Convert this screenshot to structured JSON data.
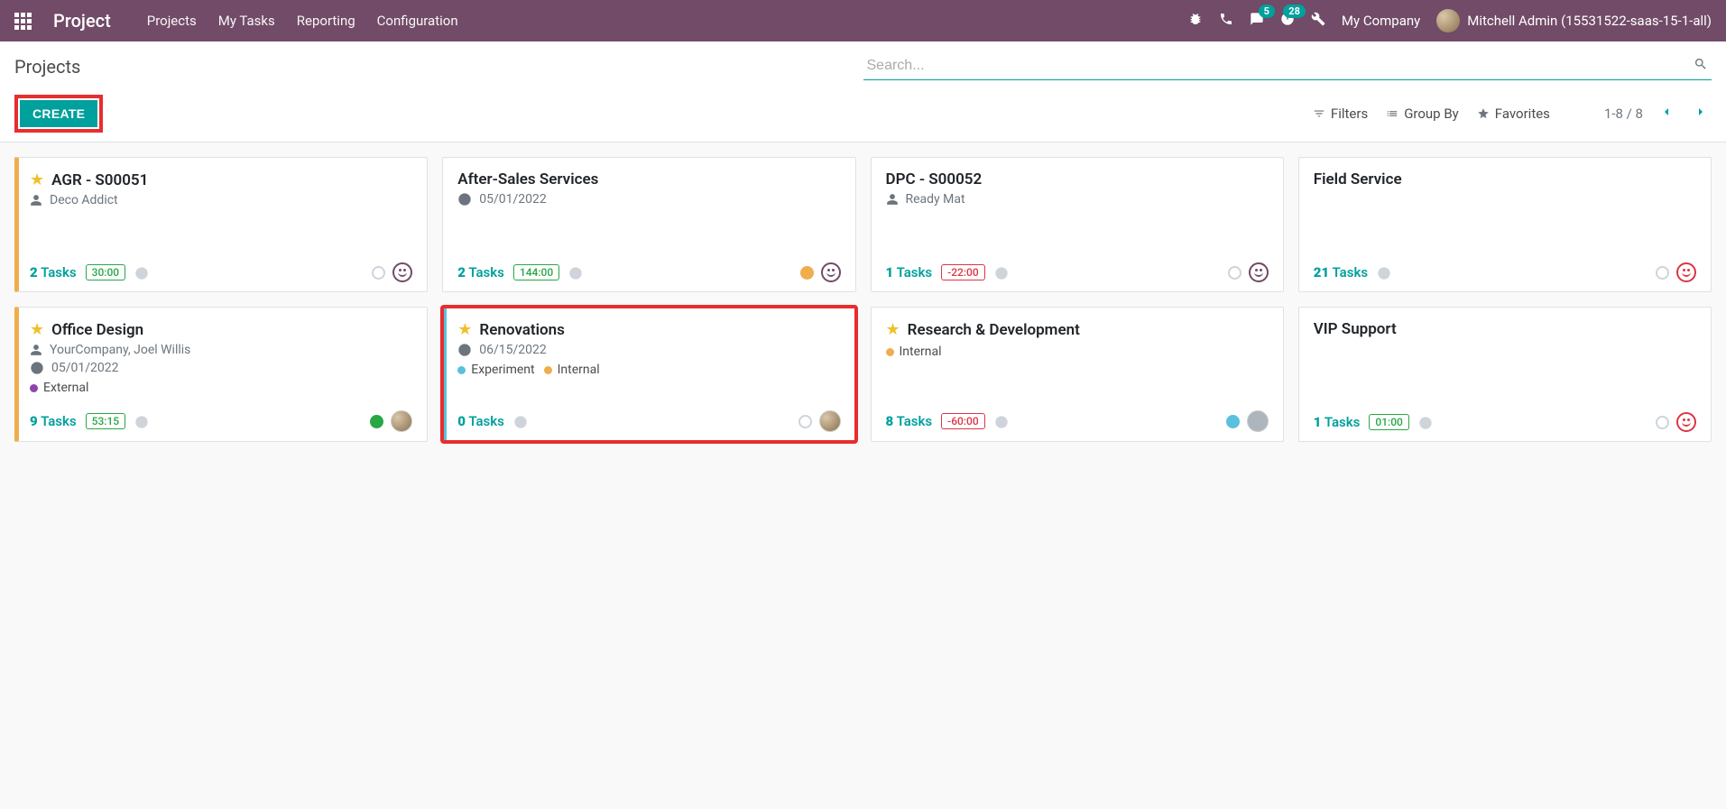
{
  "navbar": {
    "brand": "Project",
    "menu": [
      "Projects",
      "My Tasks",
      "Reporting",
      "Configuration"
    ],
    "messages_badge": "5",
    "activities_badge": "28",
    "company": "My Company",
    "user": "Mitchell Admin (15531522-saas-15-1-all)"
  },
  "control": {
    "title": "Projects",
    "create": "CREATE",
    "search_placeholder": "Search...",
    "filters": "Filters",
    "groupby": "Group By",
    "favorites": "Favorites",
    "pager": "1-8 / 8"
  },
  "projects": [
    {
      "title": "AGR - S00051",
      "starred": true,
      "partner": "Deco Addict",
      "tasks_count": "2",
      "tasks_label": "Tasks",
      "time": "30:00",
      "time_neg": false,
      "status_color": "",
      "smiley": true,
      "bar": "yellow"
    },
    {
      "title": "After-Sales Services",
      "date": "05/01/2022",
      "tasks_count": "2",
      "tasks_label": "Tasks",
      "time": "144:00",
      "time_neg": false,
      "status_color": "orange",
      "smiley": true
    },
    {
      "title": "DPC - S00052",
      "partner": "Ready Mat",
      "tasks_count": "1",
      "tasks_label": "Tasks",
      "time": "-22:00",
      "time_neg": true,
      "status_color": "",
      "smiley": true
    },
    {
      "title": "Field Service",
      "tasks_count": "21",
      "tasks_label": "Tasks",
      "status_color": "",
      "smiley_red": true
    },
    {
      "title": "Office Design",
      "starred": true,
      "partner": "YourCompany, Joel Willis",
      "date": "05/01/2022",
      "tags": [
        {
          "color": "purple",
          "label": "External"
        }
      ],
      "tasks_count": "9",
      "tasks_label": "Tasks",
      "time": "53:15",
      "time_neg": false,
      "status_color": "green",
      "avatar": true,
      "bar": "yellow"
    },
    {
      "title": "Renovations",
      "starred": true,
      "date": "06/15/2022",
      "tags": [
        {
          "color": "blue",
          "label": "Experiment"
        },
        {
          "color": "yellow",
          "label": "Internal"
        }
      ],
      "tasks_count": "0",
      "tasks_label": "Tasks",
      "status_color": "",
      "avatar": true,
      "bar": "blue",
      "highlight": true
    },
    {
      "title": "Research & Development",
      "starred": true,
      "tags": [
        {
          "color": "yellow",
          "label": "Internal"
        }
      ],
      "tasks_count": "8",
      "tasks_label": "Tasks",
      "time": "-60:00",
      "time_neg": true,
      "status_color": "blue",
      "avatar_gray": true
    },
    {
      "title": "VIP Support",
      "tasks_count": "1",
      "tasks_label": "Tasks",
      "time": "01:00",
      "time_neg": false,
      "status_color": "",
      "smiley_red": true
    }
  ]
}
